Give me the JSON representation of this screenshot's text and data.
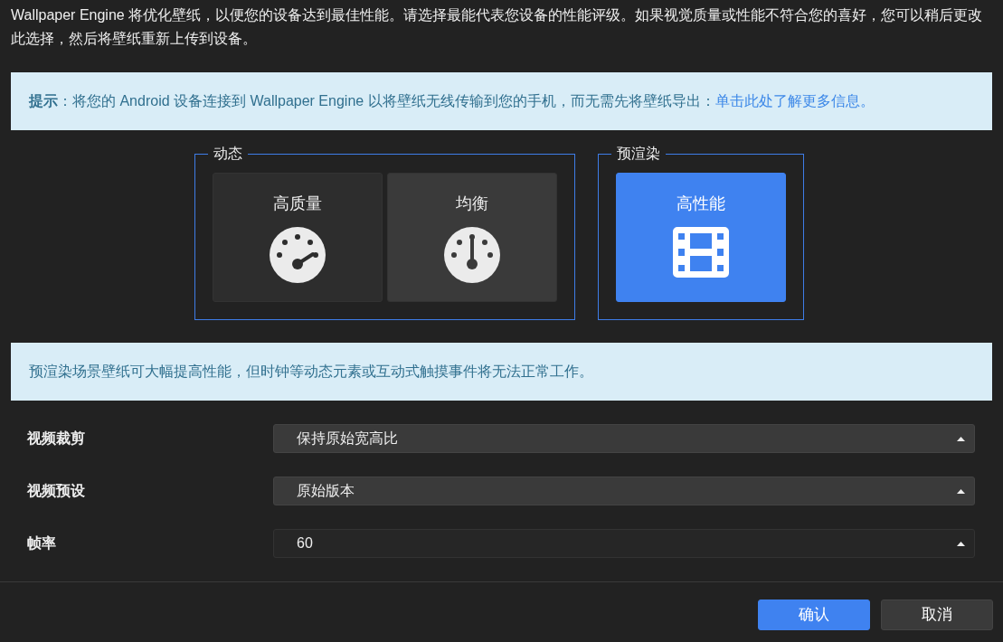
{
  "intro": "Wallpaper Engine 将优化壁纸，以便您的设备达到最佳性能。请选择最能代表您设备的性能评级。如果视觉质量或性能不符合您的喜好，您可以稍后更改此选择，然后将壁纸重新上传到设备。",
  "tip": {
    "text": "**提示**：将您的 Android 设备连接到 Wallpaper Engine 以将壁纸无线传输到您的手机，而无需先将壁纸导出：",
    "link": "单击此处了解更多信息。"
  },
  "groups": [
    {
      "legend": "动态",
      "options": [
        {
          "label": "高质量",
          "kind": "gauge-low",
          "selected": false,
          "hovered": false
        },
        {
          "label": "均衡",
          "kind": "gauge-mid",
          "selected": false,
          "hovered": true
        }
      ]
    },
    {
      "legend": "预渲染",
      "options": [
        {
          "label": "高性能",
          "kind": "film",
          "selected": true,
          "hovered": false
        }
      ]
    }
  ],
  "info": "预渲染场景壁纸可大幅提高性能，但时钟等动态元素或互动式触摸事件将无法正常工作。",
  "settings": [
    {
      "label": "视频裁剪",
      "value": "保持原始宽高比",
      "disabled": false
    },
    {
      "label": "视频预设",
      "value": "原始版本",
      "disabled": false
    },
    {
      "label": "帧率",
      "value": "60",
      "disabled": true
    }
  ],
  "buttons": [
    {
      "label": "确认",
      "kind": "primary"
    },
    {
      "label": "取消",
      "kind": "secondary"
    }
  ]
}
